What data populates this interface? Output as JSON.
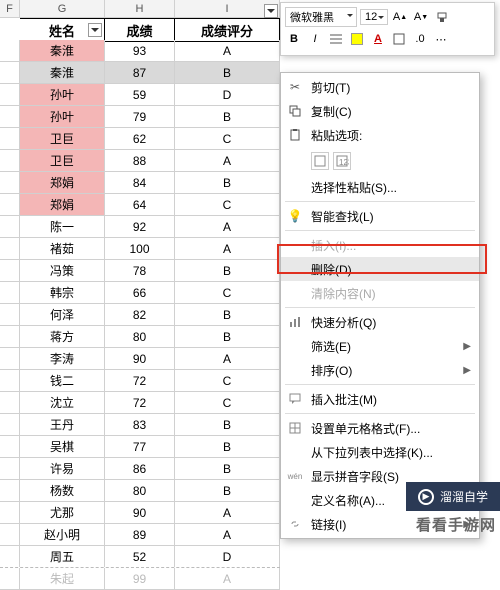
{
  "columns": {
    "f": "F",
    "g": "G",
    "h": "H",
    "i": "I"
  },
  "headers": {
    "name": "姓名",
    "score": "成绩",
    "grade": "成绩评分"
  },
  "rows": [
    {
      "name": "秦淮",
      "score": "93",
      "grade": "A",
      "style": "pink"
    },
    {
      "name": "秦淮",
      "score": "87",
      "grade": "B",
      "style": "gray-sel"
    },
    {
      "name": "孙叶",
      "score": "59",
      "grade": "D",
      "style": "pink"
    },
    {
      "name": "孙叶",
      "score": "79",
      "grade": "B",
      "style": "pink"
    },
    {
      "name": "卫巨",
      "score": "62",
      "grade": "C",
      "style": "pink"
    },
    {
      "name": "卫巨",
      "score": "88",
      "grade": "A",
      "style": "pink"
    },
    {
      "name": "郑娟",
      "score": "84",
      "grade": "B",
      "style": "pink"
    },
    {
      "name": "郑娟",
      "score": "64",
      "grade": "C",
      "style": "pink"
    },
    {
      "name": "陈一",
      "score": "92",
      "grade": "A",
      "style": ""
    },
    {
      "name": "褚茹",
      "score": "100",
      "grade": "A",
      "style": ""
    },
    {
      "name": "冯策",
      "score": "78",
      "grade": "B",
      "style": ""
    },
    {
      "name": "韩宗",
      "score": "66",
      "grade": "C",
      "style": ""
    },
    {
      "name": "何泽",
      "score": "82",
      "grade": "B",
      "style": ""
    },
    {
      "name": "蒋方",
      "score": "80",
      "grade": "B",
      "style": ""
    },
    {
      "name": "李涛",
      "score": "90",
      "grade": "A",
      "style": ""
    },
    {
      "name": "钱二",
      "score": "72",
      "grade": "C",
      "style": ""
    },
    {
      "name": "沈立",
      "score": "72",
      "grade": "C",
      "style": ""
    },
    {
      "name": "王丹",
      "score": "83",
      "grade": "B",
      "style": ""
    },
    {
      "name": "吴棋",
      "score": "77",
      "grade": "B",
      "style": ""
    },
    {
      "name": "许易",
      "score": "86",
      "grade": "B",
      "style": ""
    },
    {
      "name": "杨数",
      "score": "80",
      "grade": "B",
      "style": ""
    },
    {
      "name": "尤那",
      "score": "90",
      "grade": "A",
      "style": ""
    },
    {
      "name": "赵小明",
      "score": "89",
      "grade": "A",
      "style": ""
    },
    {
      "name": "周五",
      "score": "52",
      "grade": "D",
      "style": ""
    },
    {
      "name": "朱起",
      "score": "99",
      "grade": "A",
      "style": "ghost"
    }
  ],
  "toolbar": {
    "font": "微软雅黑",
    "size": "12",
    "bold": "B",
    "italic": "I"
  },
  "menu": {
    "cut": "剪切(T)",
    "copy": "复制(C)",
    "paste_opts": "粘贴选项:",
    "paste_special": "选择性粘贴(S)...",
    "smart_lookup": "智能查找(L)",
    "insert": "插入(I)...",
    "delete": "删除(D)...",
    "clear": "清除内容(N)",
    "quick_analysis": "快速分析(Q)",
    "filter": "筛选(E)",
    "sort": "排序(O)",
    "insert_comment": "插入批注(M)",
    "format_cells": "设置单元格格式(F)...",
    "pick_from_list": "从下拉列表中选择(K)...",
    "show_pinyin": "显示拼音字段(S)",
    "define_name": "定义名称(A)...",
    "link": "链接(I)"
  },
  "watermark": "溜溜自学",
  "footer": "看看手游网"
}
